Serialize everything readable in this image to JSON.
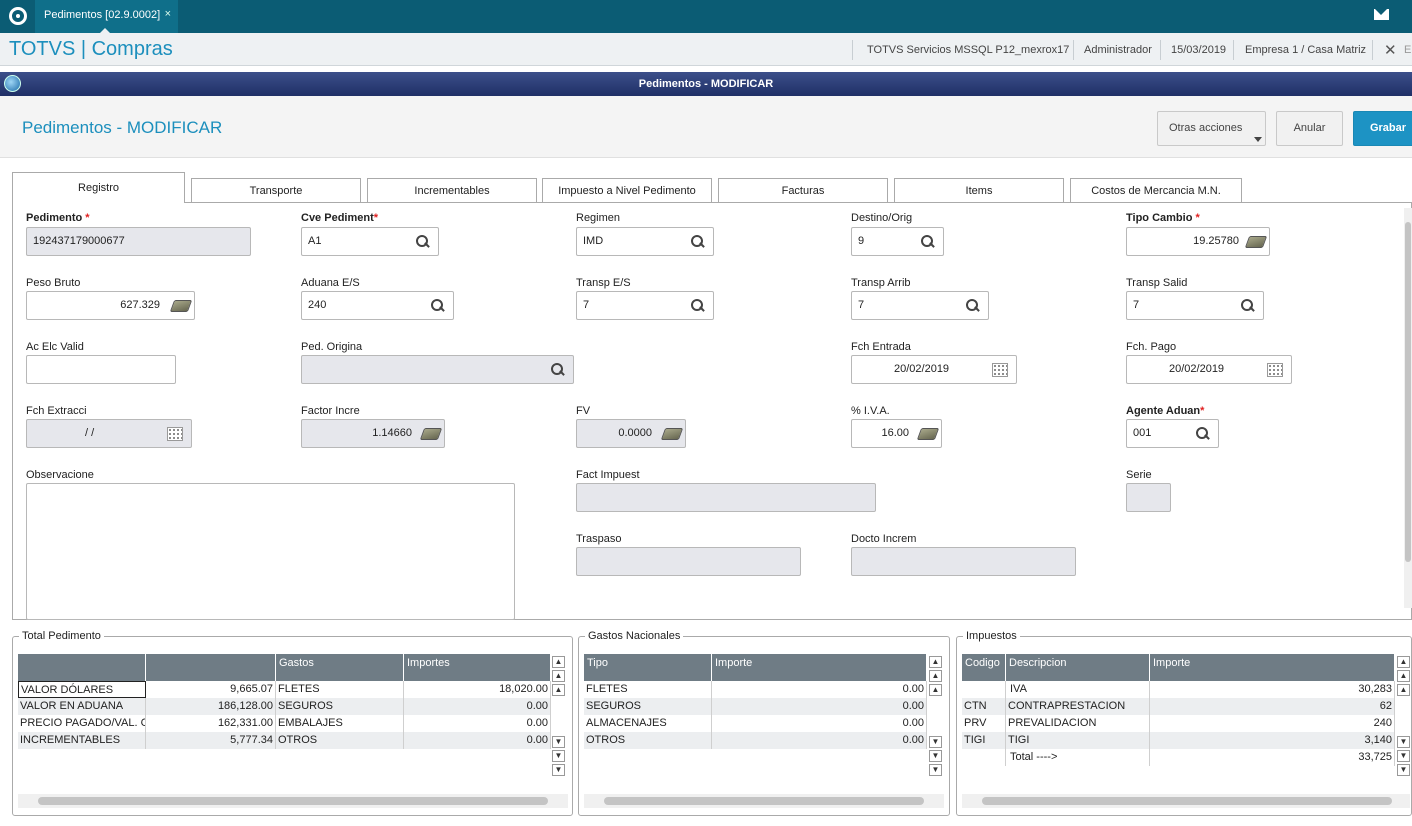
{
  "topbar": {
    "tab_label": "Pedimentos [02.9.0002]",
    "tab_close": "×"
  },
  "appbar": {
    "title": "TOTVS | Compras",
    "server": "TOTVS Servicios MSSQL P12_mexrox17",
    "user": "Administrador",
    "date": "15/03/2019",
    "company": "Empresa 1 / Casa Matriz",
    "exit": "E"
  },
  "window": {
    "title": "Pedimentos - MODIFICAR"
  },
  "page": {
    "title": "Pedimentos - MODIFICAR",
    "btn_otras": "Otras acciones",
    "btn_anular": "Anular",
    "btn_grabar": "Grabar"
  },
  "tabs": [
    "Registro",
    "Transporte",
    "Incrementables",
    "Impuesto a Nivel Pedimento",
    "Facturas",
    "Items",
    "Costos de Mercancia M.N."
  ],
  "fields": {
    "pedimento": {
      "label": "Pedimento",
      "value": "192437179000677"
    },
    "cve_pediment": {
      "label": "Cve Pediment",
      "value": "A1"
    },
    "regimen": {
      "label": "Regimen",
      "value": "IMD"
    },
    "destino_orig": {
      "label": "Destino/Orig",
      "value": "9"
    },
    "tipo_cambio": {
      "label": "Tipo Cambio",
      "value": "19.25780"
    },
    "peso_bruto": {
      "label": "Peso Bruto",
      "value": "627.329"
    },
    "aduana_es": {
      "label": "Aduana E/S",
      "value": "240"
    },
    "transp_es": {
      "label": "Transp E/S",
      "value": "7"
    },
    "transp_arrib": {
      "label": "Transp Arrib",
      "value": "7"
    },
    "transp_salid": {
      "label": "Transp Salid",
      "value": "7"
    },
    "ac_elc_valid": {
      "label": "Ac Elc Valid",
      "value": ""
    },
    "ped_origina": {
      "label": "Ped. Origina",
      "value": ""
    },
    "fch_entrada": {
      "label": "Fch Entrada",
      "value": "20/02/2019"
    },
    "fch_pago": {
      "label": "Fch. Pago",
      "value": "20/02/2019"
    },
    "fch_extracci": {
      "label": "Fch Extracci",
      "value": " /  /"
    },
    "factor_incre": {
      "label": "Factor Incre",
      "value": "1.14660"
    },
    "fv": {
      "label": "FV",
      "value": "0.0000"
    },
    "iva": {
      "label": "% I.V.A.",
      "value": "16.00"
    },
    "agente_aduan": {
      "label": "Agente Aduan",
      "value": "001"
    },
    "observacione": {
      "label": "Observacione",
      "value": ""
    },
    "fact_impuest": {
      "label": "Fact Impuest",
      "value": ""
    },
    "serie": {
      "label": "Serie",
      "value": ""
    },
    "traspaso": {
      "label": "Traspaso",
      "value": ""
    },
    "docto_increm": {
      "label": "Docto Increm",
      "value": ""
    }
  },
  "total_pedimento": {
    "title": "Total Pedimento",
    "headers": [
      "",
      "",
      "Gastos",
      "Importes"
    ],
    "rows": [
      [
        "VALOR DÓLARES",
        "9,665.07",
        "FLETES",
        "18,020.00"
      ],
      [
        "VALOR EN ADUANA",
        "186,128.00",
        "SEGUROS",
        "0.00"
      ],
      [
        "PRECIO PAGADO/VAL. C(",
        "162,331.00",
        "EMBALAJES",
        "0.00"
      ],
      [
        "INCREMENTABLES",
        "5,777.34",
        "OTROS",
        "0.00"
      ]
    ]
  },
  "gastos_nacionales": {
    "title": "Gastos Nacionales",
    "headers": [
      "Tipo",
      "Importe"
    ],
    "rows": [
      [
        "FLETES",
        "0.00"
      ],
      [
        "SEGUROS",
        "0.00"
      ],
      [
        "ALMACENAJES",
        "0.00"
      ],
      [
        "OTROS",
        "0.00"
      ]
    ]
  },
  "impuestos": {
    "title": "Impuestos",
    "headers": [
      "Codigo",
      "Descripcion",
      "Importe"
    ],
    "rows": [
      [
        "",
        "IVA",
        "30,283"
      ],
      [
        "CTN",
        "CONTRAPRESTACION",
        "62"
      ],
      [
        "PRV",
        "PREVALIDACION",
        "240"
      ],
      [
        "TIGI",
        "TIGI",
        "3,140"
      ],
      [
        "",
        "Total  ---->",
        "33,725"
      ]
    ]
  }
}
